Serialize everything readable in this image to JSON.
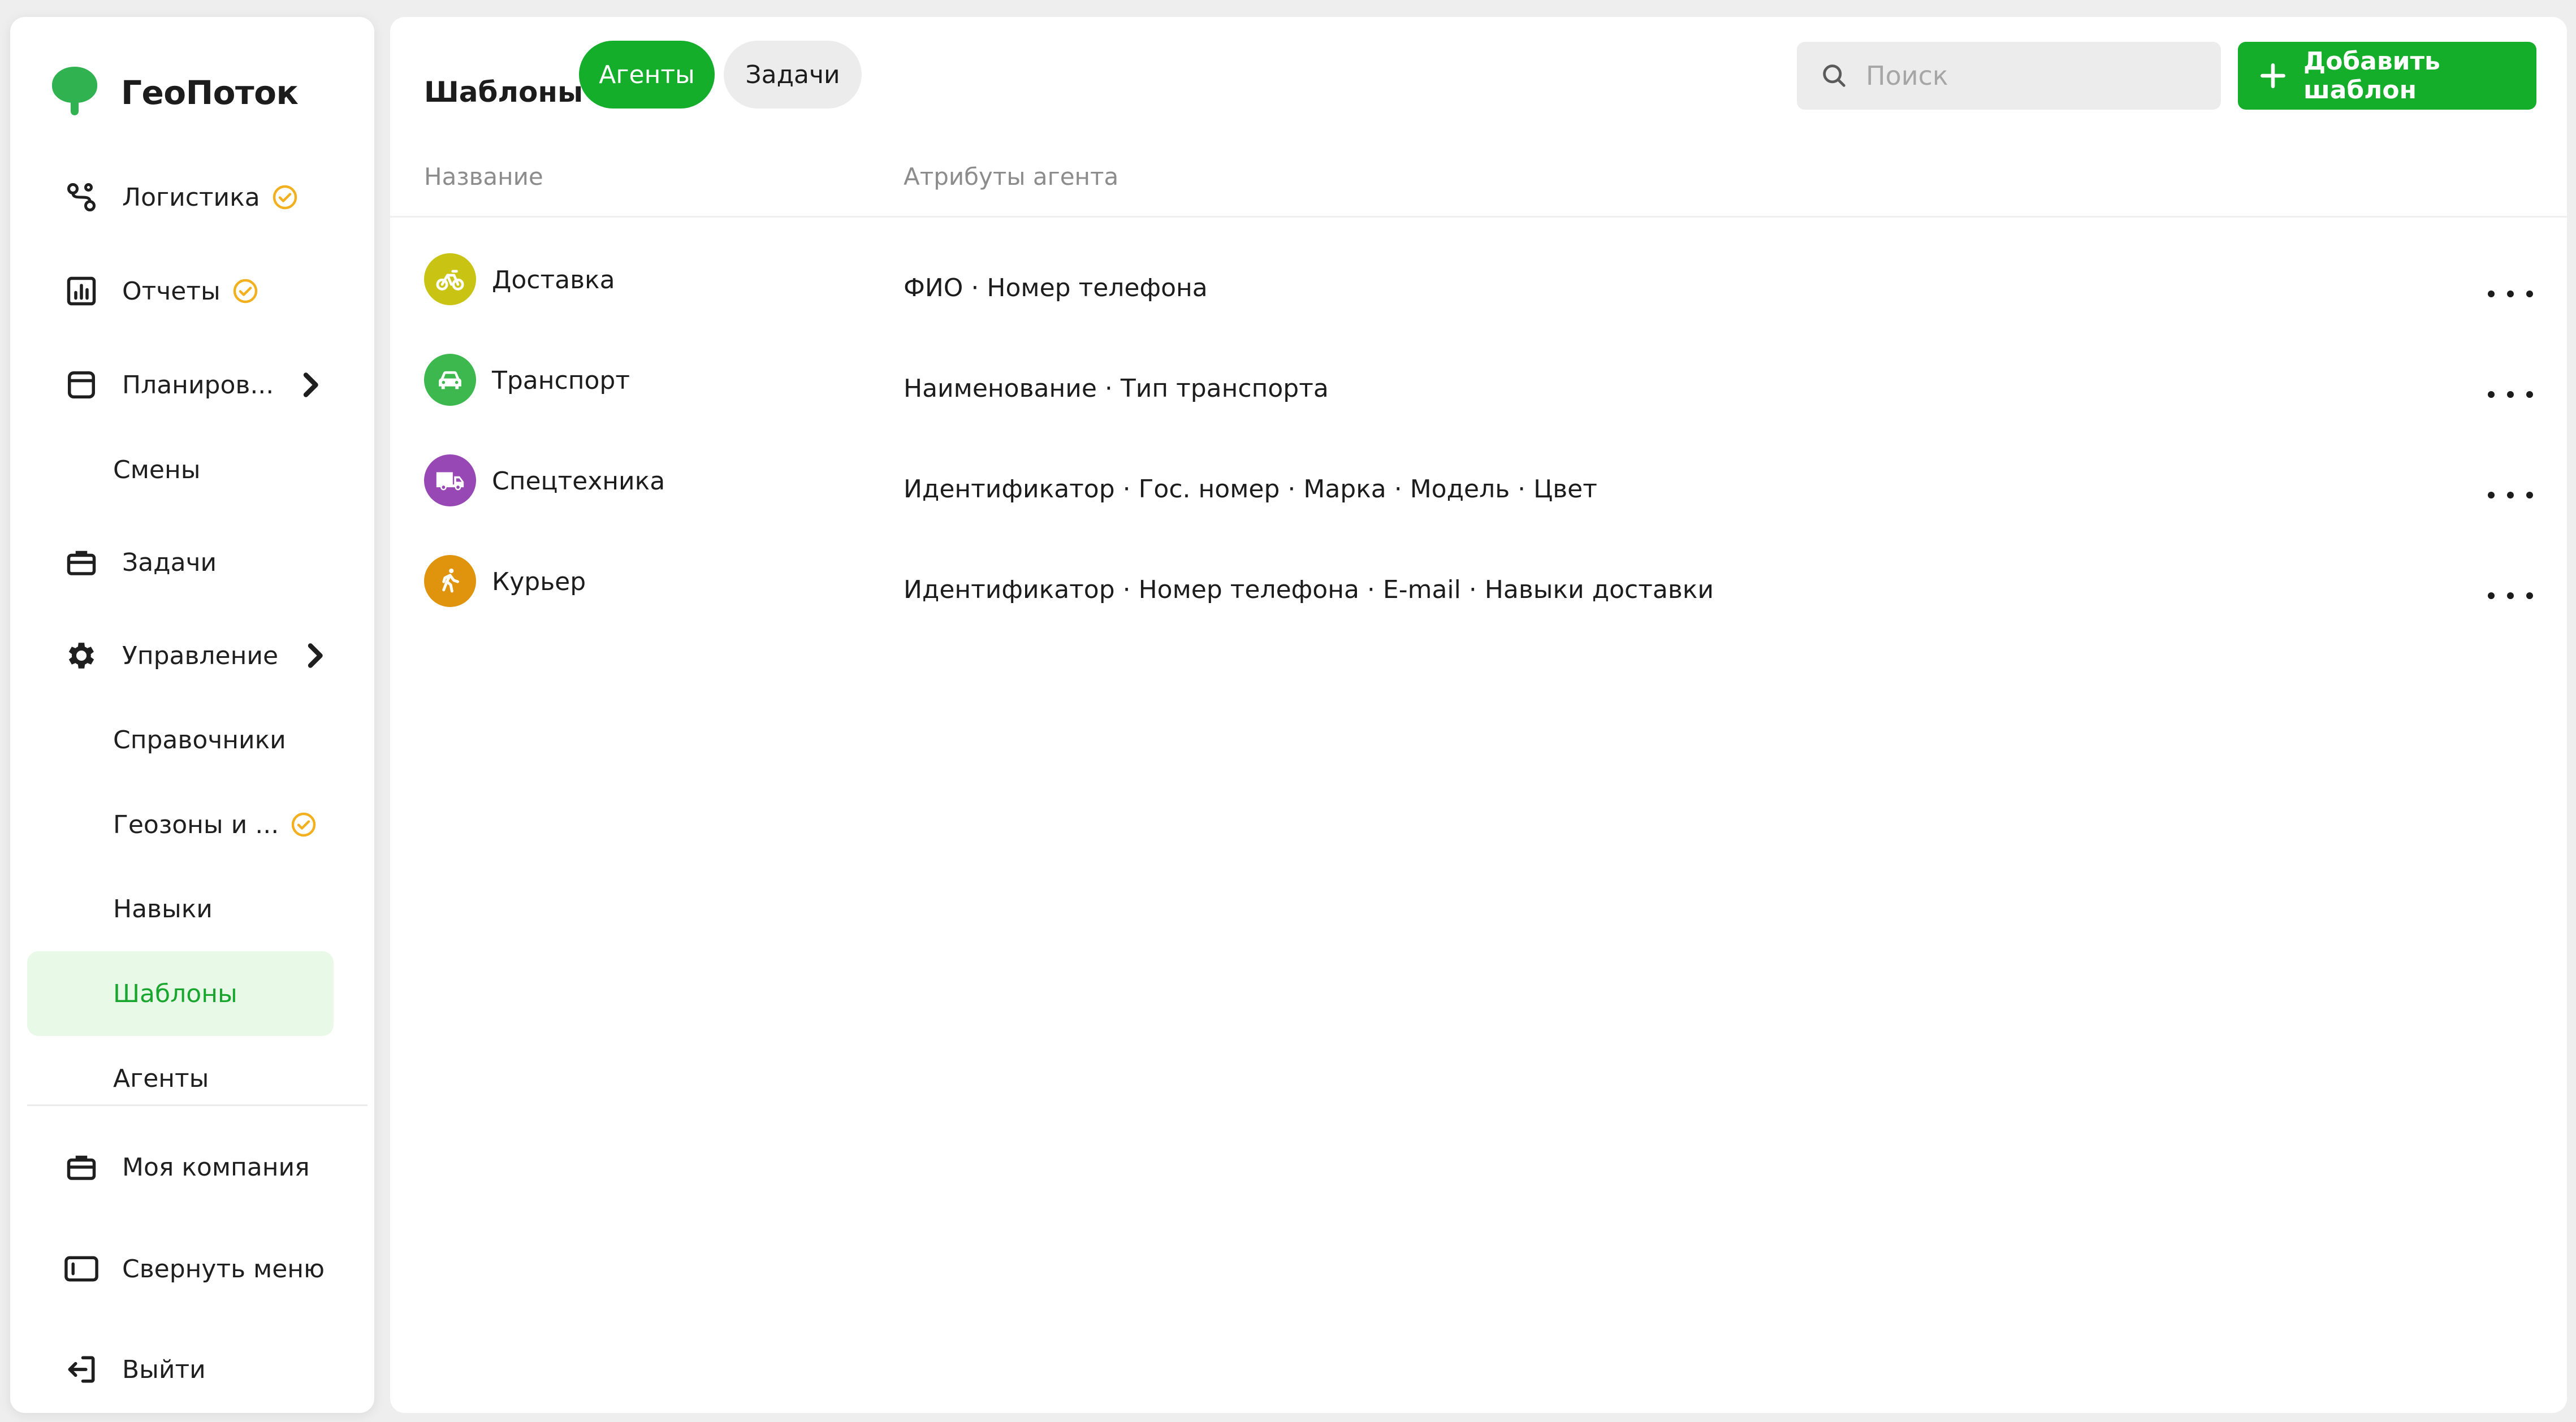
{
  "app": {
    "name": "ГеоПоток",
    "brand_color": "#14ae2b"
  },
  "sidebar": {
    "items": [
      {
        "label": "Логистика",
        "icon": "route-icon",
        "badge": "check-circle-icon"
      },
      {
        "label": "Отчеты",
        "icon": "chart-icon",
        "badge": "check-circle-icon"
      },
      {
        "label": "Планиров...",
        "icon": "calendar-icon",
        "expand": "chevron-right-icon"
      },
      {
        "label": "Смены"
      },
      {
        "label": "Задачи",
        "icon": "briefcase-icon"
      },
      {
        "label": "Управление",
        "icon": "gear-icon",
        "expand": "chevron-right-icon"
      },
      {
        "label": "Справочники"
      },
      {
        "label": "Геозоны и ...",
        "badge": "check-circle-icon"
      },
      {
        "label": "Навыки"
      },
      {
        "label": "Шаблоны",
        "active": true
      },
      {
        "label": "Агенты"
      }
    ],
    "footer": [
      {
        "label": "Моя компания",
        "icon": "briefcase-icon"
      },
      {
        "label": "Свернуть меню",
        "icon": "collapse-sidebar-icon"
      },
      {
        "label": "Выйти",
        "icon": "logout-icon"
      }
    ]
  },
  "main": {
    "title": "Шаблоны",
    "tabs": [
      {
        "label": "Агенты",
        "selected": true
      },
      {
        "label": "Задачи",
        "selected": false
      }
    ],
    "search": {
      "placeholder": "Поиск",
      "value": ""
    },
    "add_button": "Добавить шаблон",
    "columns": [
      "Название",
      "Атрибуты агента"
    ],
    "rows": [
      {
        "name": "Доставка",
        "attributes": "ФИО · Номер телефона",
        "icon": "bicycle-icon",
        "color": "#c9c414"
      },
      {
        "name": "Транспорт",
        "attributes": "Наименование · Тип транспорта",
        "icon": "car-icon",
        "color": "#3cb84e"
      },
      {
        "name": "Спецтехника",
        "attributes": "Идентификатор · Гос. номер · Марка · Модель · Цвет",
        "icon": "truck-icon",
        "color": "#9848b5"
      },
      {
        "name": "Курьер",
        "attributes": "Идентификатор · Номер телефона · E-mail · Навыки доставки",
        "icon": "walking-person-icon",
        "color": "#e0940d"
      }
    ]
  }
}
